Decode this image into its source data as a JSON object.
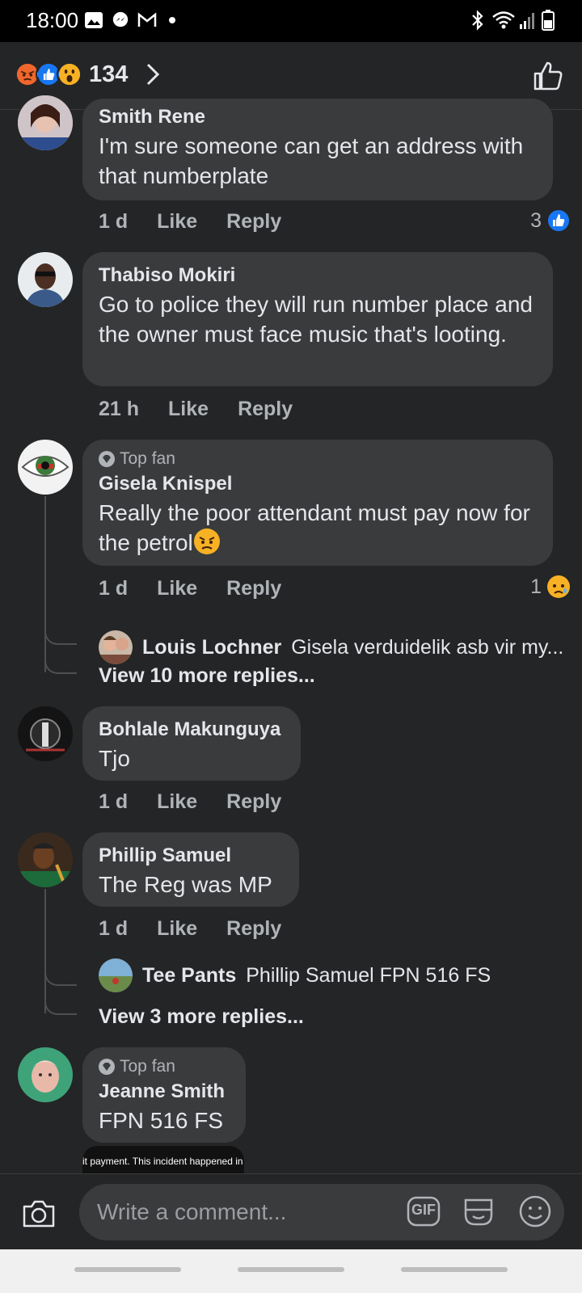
{
  "status_bar": {
    "time": "18:00"
  },
  "header": {
    "reaction_count": "134"
  },
  "comments": [
    {
      "author": "Smith Rene",
      "text": "I'm sure someone can get an address with that numberplate",
      "time": "1 d",
      "like_label": "Like",
      "reply_label": "Reply",
      "reaction_count": "3"
    },
    {
      "author": "Thabiso Mokiri",
      "text": "Go to police they will  run number place and the owner  must face music that's looting.",
      "time": "21 h",
      "like_label": "Like",
      "reply_label": "Reply"
    },
    {
      "badge": "Top fan",
      "author": "Gisela Knispel",
      "text": "Really the poor attendant must pay now for the petrol",
      "time": "1 d",
      "like_label": "Like",
      "reply_label": "Reply",
      "reaction_count": "1",
      "reply_preview": {
        "author": "Louis Lochner",
        "text": "Gisela verduidelik asb vir my..."
      },
      "more_replies": "View 10 more replies..."
    },
    {
      "author": "Bohlale Makunguya",
      "text": "Tjo",
      "time": "1 d",
      "like_label": "Like",
      "reply_label": "Reply"
    },
    {
      "author": "Phillip Samuel",
      "text": "The Reg was MP",
      "time": "1 d",
      "like_label": "Like",
      "reply_label": "Reply",
      "reply_preview": {
        "author": "Tee Pants",
        "text": "Phillip Samuel FPN 516 FS"
      },
      "more_replies": "View 3 more replies..."
    },
    {
      "badge": "Top fan",
      "author": "Jeanne Smith",
      "text": "FPN 516 FS",
      "attachment_caption": "it payment. This incident happened in"
    }
  ],
  "composer": {
    "placeholder": "Write a comment...",
    "gif_label": "GIF"
  },
  "colors": {
    "background": "#242526",
    "bubble": "#3a3b3c",
    "muted": "#b0b3b8",
    "accent": "#1877f2"
  }
}
